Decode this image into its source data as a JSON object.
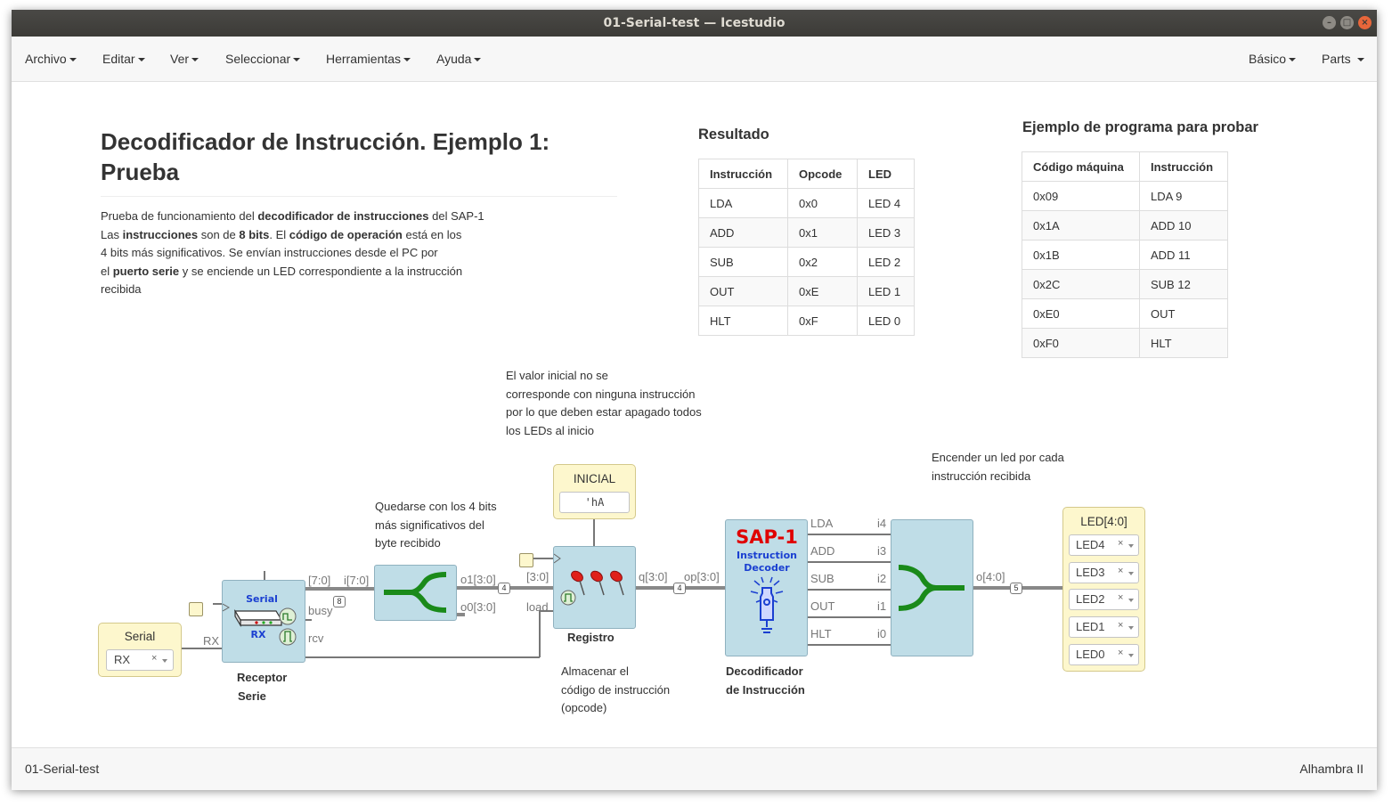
{
  "window": {
    "title": "01-Serial-test — Icestudio"
  },
  "menu": {
    "archivo": "Archivo",
    "editar": "Editar",
    "ver": "Ver",
    "seleccionar": "Seleccionar",
    "herramientas": "Herramientas",
    "ayuda": "Ayuda",
    "basico": "Básico",
    "parts": "Parts"
  },
  "doc": {
    "title": "Decodificador de Instrucción. Ejemplo 1: Prueba",
    "p1_pre": "Prueba de funcionamiento del ",
    "p1_bold": "decodificador de instrucciones",
    "p1_post": " del SAP-1",
    "p2_a": "Las ",
    "p2_b": "instrucciones",
    "p2_c": " son de ",
    "p2_d": "8 bits",
    "p2_e": ". El ",
    "p2_f": "código de operación",
    "p2_g": " está en los",
    "p3": "4 bits más significativos. Se envían instrucciones desde el PC por",
    "p4_a": "el ",
    "p4_b": "puerto serie",
    "p4_c": " y se enciende un LED correspondiente a la instrucción",
    "p5": "recibida"
  },
  "resultado": {
    "title": "Resultado",
    "headers": [
      "Instrucción",
      "Opcode",
      "LED"
    ],
    "rows": [
      [
        "LDA",
        "0x0",
        "LED 4"
      ],
      [
        "ADD",
        "0x1",
        "LED 3"
      ],
      [
        "SUB",
        "0x2",
        "LED 2"
      ],
      [
        "OUT",
        "0xE",
        "LED 1"
      ],
      [
        "HLT",
        "0xF",
        "LED 0"
      ]
    ]
  },
  "ejemplo": {
    "title": "Ejemplo de programa para probar",
    "headers": [
      "Código máquina",
      "Instrucción"
    ],
    "rows": [
      [
        "0x09",
        "LDA 9"
      ],
      [
        "0x1A",
        "ADD 10"
      ],
      [
        "0x1B",
        "ADD 11"
      ],
      [
        "0x2C",
        "SUB 12"
      ],
      [
        "0xE0",
        "OUT"
      ],
      [
        "0xF0",
        "HLT"
      ]
    ]
  },
  "notes": {
    "inicial_l1": "El valor inicial no se",
    "inicial_l2": "corresponde con ninguna instrucción",
    "inicial_l3": "por lo que deben estar apagado todos",
    "inicial_l4": "los LEDs al inicio",
    "quedarse_l1": "Quedarse con los 4 bits",
    "quedarse_l2": "más significativos del",
    "quedarse_l3": "byte recibido",
    "encender_l1": "Encender un led por cada",
    "encender_l2": "instrucción recibida",
    "almacenar_l1": "Almacenar el",
    "almacenar_l2": "código de instrucción",
    "almacenar_l3": "(opcode)"
  },
  "blocks": {
    "serial_input": {
      "label": "Serial",
      "value": "RX"
    },
    "receptor": {
      "line1": "Receptor",
      "line2": "Serie",
      "icon_top": "Serial",
      "icon_bottom": "RX",
      "port_rx": "RX",
      "port_data": "[7:0]",
      "port_busy": "busy",
      "port_rcv": "rcv"
    },
    "splitter1": {
      "port_in": "i[7:0]",
      "port_o1": "o1[3:0]",
      "port_o0": "o0[3:0]"
    },
    "inicial": {
      "label": "INICIAL",
      "value": "'hA"
    },
    "registro": {
      "label": "Registro",
      "port_in": "[3:0]",
      "port_load": "load",
      "port_out": "q[3:0]"
    },
    "decoder": {
      "line1": "Decodificador",
      "line2": "de Instrucción",
      "brand": "SAP-1",
      "sub1": "Instruction",
      "sub2": "Decoder",
      "port_in": "op[3:0]",
      "outs": [
        "LDA",
        "ADD",
        "SUB",
        "OUT",
        "HLT"
      ]
    },
    "joiner": {
      "ins": [
        "i4",
        "i3",
        "i2",
        "i1",
        "i0"
      ],
      "port_out": "o[4:0]"
    },
    "led_output": {
      "label": "LED[4:0]",
      "values": [
        "LED4",
        "LED3",
        "LED2",
        "LED1",
        "LED0"
      ]
    },
    "bus_widths": {
      "w8": "8",
      "w4a": "4",
      "w4b": "4",
      "w5": "5"
    }
  },
  "status": {
    "project": "01-Serial-test",
    "board": "Alhambra II"
  },
  "colors": {
    "block_fill": "#bfdde7",
    "io_fill": "#fdf7cd",
    "sap_red": "#e00000",
    "sap_blue": "#1a3fd1",
    "splitter_green": "#1a8a1a"
  }
}
